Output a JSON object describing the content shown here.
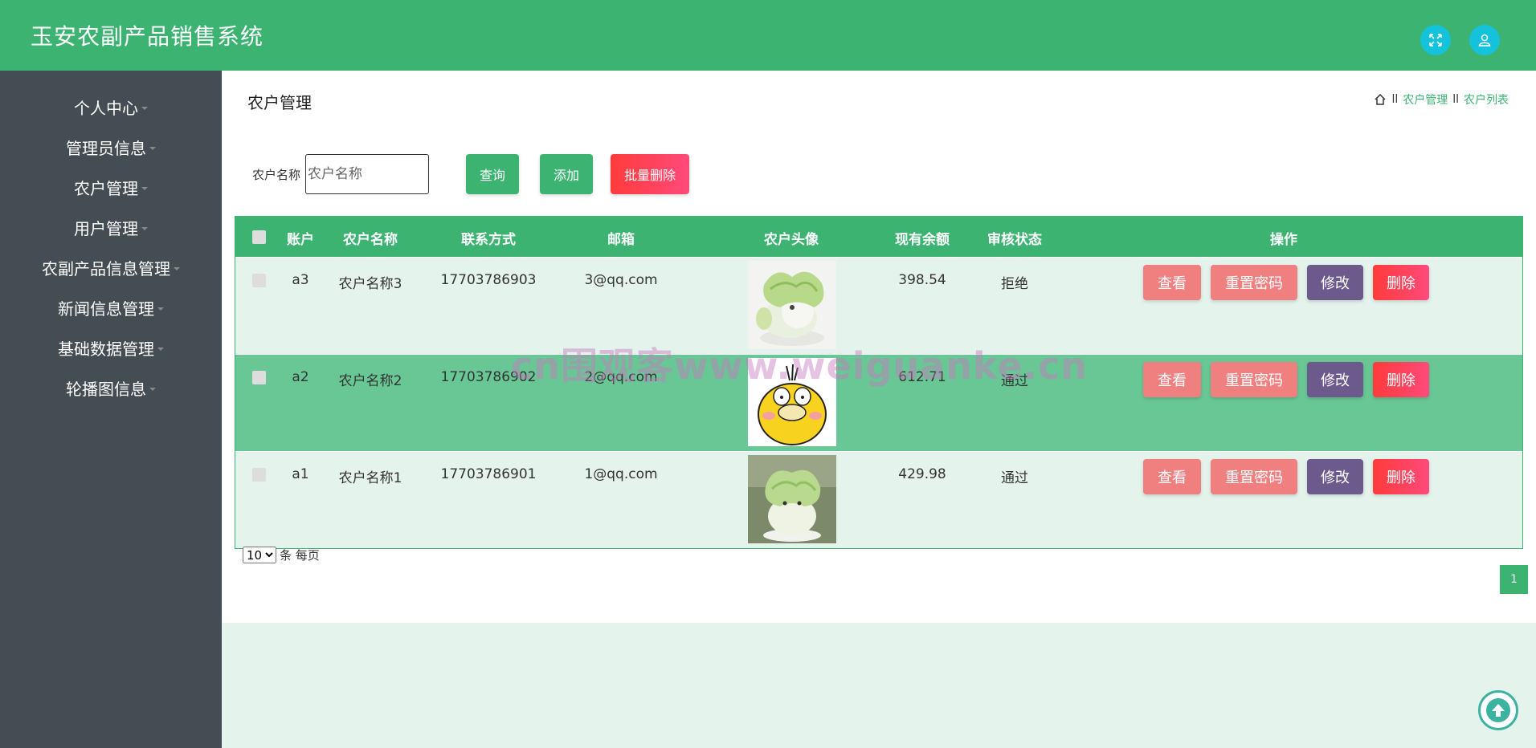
{
  "header": {
    "title": "玉安农副产品销售系统",
    "fullscreen_icon": "fullscreen-icon",
    "user_icon": "user-icon",
    "accent_color": "#3cb371"
  },
  "sidebar": {
    "items": [
      {
        "label": "个人中心"
      },
      {
        "label": "管理员信息"
      },
      {
        "label": "农户管理"
      },
      {
        "label": "用户管理"
      },
      {
        "label": "农副产品信息管理"
      },
      {
        "label": "新闻信息管理"
      },
      {
        "label": "基础数据管理"
      },
      {
        "label": "轮播图信息"
      }
    ]
  },
  "main": {
    "page_title": "农户管理",
    "breadcrumb": {
      "home_icon": "home-icon",
      "items": [
        "农户管理",
        "农户列表"
      ],
      "separator": "ll"
    },
    "search": {
      "label": "农户名称",
      "placeholder": "农户名称",
      "query_button": "查询",
      "add_button": "添加",
      "batch_delete_button": "批量删除"
    },
    "table": {
      "columns": [
        "账户",
        "农户名称",
        "联系方式",
        "邮箱",
        "农户头像",
        "现有余额",
        "审核状态",
        "操作"
      ],
      "rows": [
        {
          "account": "a3",
          "name": "农户名称3",
          "phone": "17703786903",
          "email": "3@qq.com",
          "avatar": "cabbage-dog-image",
          "balance": "398.54",
          "status": "拒绝"
        },
        {
          "account": "a2",
          "name": "农户名称2",
          "phone": "17703786902",
          "email": "2@qq.com",
          "avatar": "psyduck-image",
          "balance": "612.71",
          "status": "通过"
        },
        {
          "account": "a1",
          "name": "农户名称1",
          "phone": "17703786901",
          "email": "1@qq.com",
          "avatar": "cabbage-dog-image",
          "balance": "429.98",
          "status": "通过"
        }
      ],
      "actions": {
        "view": "查看",
        "reset": "重置密码",
        "edit": "修改",
        "delete": "删除"
      }
    },
    "pager": {
      "page_size": "10",
      "page_size_suffix": "条 每页",
      "current_page": "1"
    }
  },
  "watermark": "cn围观客www.weiguanke.cn"
}
